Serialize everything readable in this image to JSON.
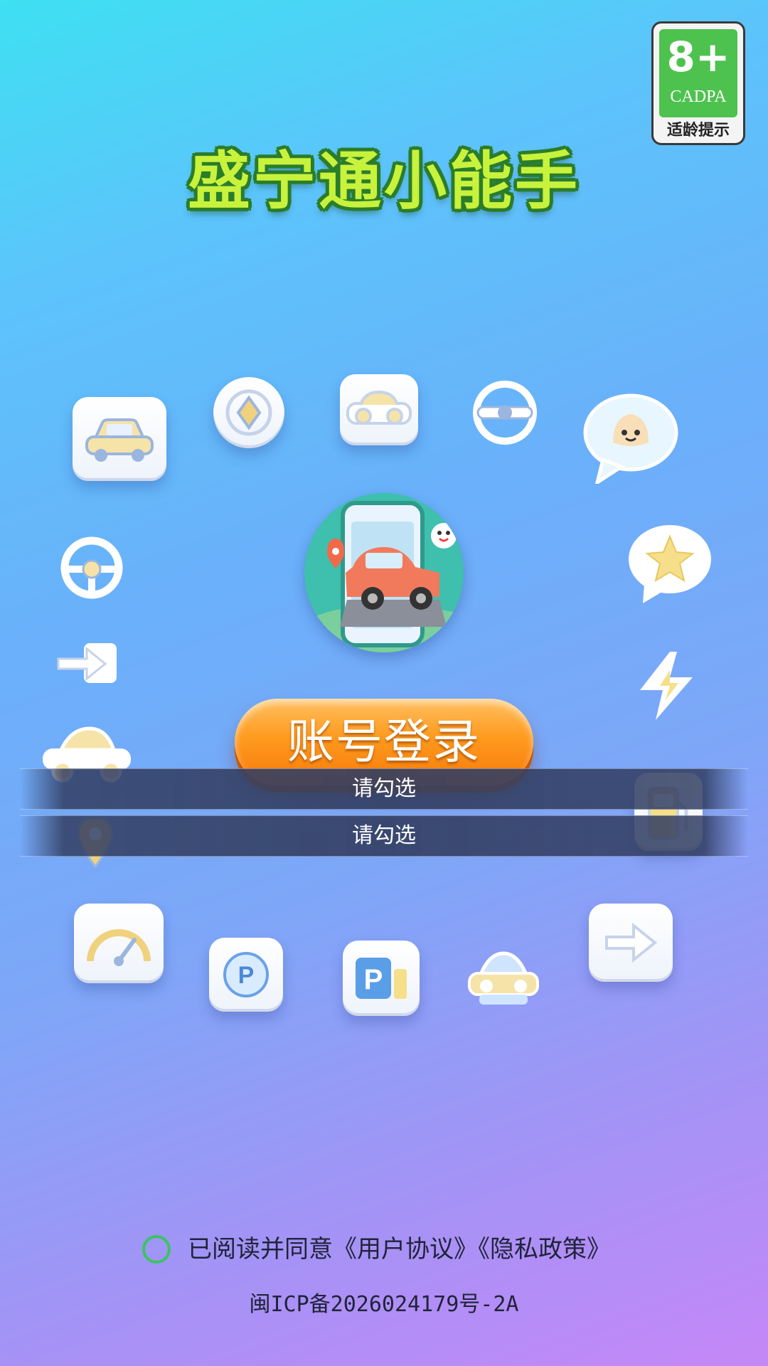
{
  "age_badge": {
    "age": "8+",
    "org": "CADPA",
    "hint": "适龄提示",
    "color": "#4ec24e"
  },
  "app": {
    "title": "盛宁通小能手"
  },
  "decor_icons": [
    "car-icon",
    "shield-badge-icon",
    "car-front-icon",
    "steering-wheel-icon",
    "chat-face-icon",
    "steering-wheel-icon",
    "chat-star-icon",
    "arrow-right-icon",
    "lightning-icon",
    "car-side-icon",
    "fuel-pump-icon",
    "location-pin-icon",
    "speedometer-icon",
    "parking-icon",
    "parking-fuel-icon",
    "car-icon",
    "arrow-right-icon"
  ],
  "logo": {
    "icon": "phone-car-logo"
  },
  "login": {
    "label": "账号登录",
    "color": "#ff9a1f"
  },
  "toasts": [
    "请勾选",
    "请勾选"
  ],
  "agreement": {
    "text": "已阅读并同意《用户协议》《隐私政策》",
    "checked": false,
    "check_color": "#39c55f"
  },
  "footer": {
    "icp": "闽ICP备2026024179号-2A"
  }
}
